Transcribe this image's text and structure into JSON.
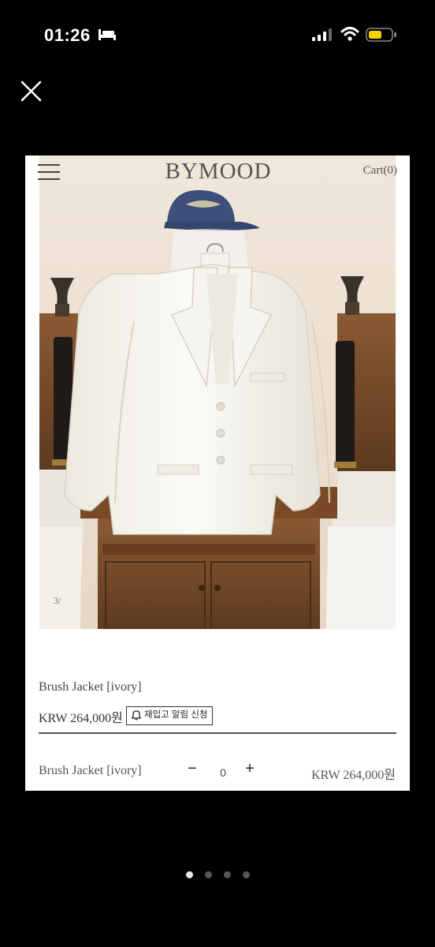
{
  "status_bar": {
    "time": "01:26"
  },
  "store": {
    "brand": "BYMOOD",
    "cart_label": "Cart(0)",
    "slide_counter": "3/"
  },
  "product": {
    "name": "Brush Jacket [ivory]",
    "price": "KRW 264,000원",
    "restock_label": "재입고 알림 신청"
  },
  "option_row": {
    "name": "Brush Jacket [ivory]",
    "minus": "−",
    "quantity": "0",
    "plus": "+",
    "price": "KRW 264,000원"
  },
  "pager": {
    "total": 4,
    "active_index": 0
  },
  "colors": {
    "background": "#000000",
    "battery": "#f5d300",
    "card": "#ffffff"
  }
}
